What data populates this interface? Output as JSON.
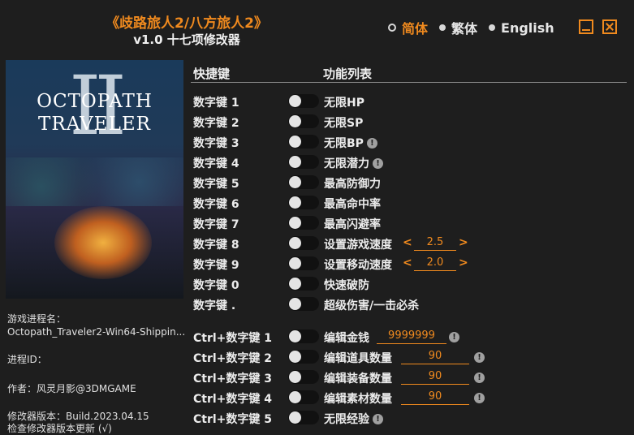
{
  "header": {
    "title": "《歧路旅人2/八方旅人2》",
    "subtitle": "v1.0 十七项修改器"
  },
  "languages": [
    {
      "label": "简体",
      "selected": true
    },
    {
      "label": "繁体",
      "selected": false
    },
    {
      "label": "English",
      "selected": false
    }
  ],
  "window_buttons": {
    "minimize": "minimize-icon",
    "close": "close-icon"
  },
  "cover": {
    "title_line1": "OCTOPATH",
    "title_line2": "TRAVELER",
    "numeral": "II"
  },
  "info": {
    "process_label": "游戏进程名：",
    "process_value": "Octopath_Traveler2-Win64-Shippin...",
    "pid_label": "进程ID：",
    "author": "作者：风灵月影@3DMGAME",
    "version": "修改器版本：Build.2023.04.15",
    "update": "检查修改器版本更新 (√)"
  },
  "table_headers": {
    "hotkey": "快捷键",
    "features": "功能列表"
  },
  "cheats": [
    {
      "hotkey": "数字键 1",
      "name": "无限HP",
      "on": false
    },
    {
      "hotkey": "数字键 2",
      "name": "无限SP",
      "on": false
    },
    {
      "hotkey": "数字键 3",
      "name": "无限BP",
      "on": false,
      "warning": true
    },
    {
      "hotkey": "数字键 4",
      "name": "无限潜力",
      "on": false,
      "warning": true
    },
    {
      "hotkey": "数字键 5",
      "name": "最高防御力",
      "on": false
    },
    {
      "hotkey": "数字键 6",
      "name": "最高命中率",
      "on": false
    },
    {
      "hotkey": "数字键 7",
      "name": "最高闪避率",
      "on": false
    },
    {
      "hotkey": "数字键 8",
      "name": "设置游戏速度",
      "on": false,
      "value": "2.5",
      "dec": "<",
      "inc": ">"
    },
    {
      "hotkey": "数字键 9",
      "name": "设置移动速度",
      "on": false,
      "value": "2.0",
      "dec": "<",
      "inc": ">"
    },
    {
      "hotkey": "数字键 0",
      "name": "快速破防",
      "on": false
    },
    {
      "hotkey": "数字键 .",
      "name": "超级伤害/一击必杀",
      "on": false
    },
    {
      "hotkey": "Ctrl+数字键 1",
      "name": "编辑金钱",
      "on": false,
      "input": "9999999",
      "warning": true
    },
    {
      "hotkey": "Ctrl+数字键 2",
      "name": "编辑道具数量",
      "on": false,
      "input": "90",
      "warning": true
    },
    {
      "hotkey": "Ctrl+数字键 3",
      "name": "编辑装备数量",
      "on": false,
      "input": "90",
      "warning": true
    },
    {
      "hotkey": "Ctrl+数字键 4",
      "name": "编辑素材数量",
      "on": false,
      "input": "90",
      "warning": true
    },
    {
      "hotkey": "Ctrl+数字键 5",
      "name": "无限经验",
      "on": false,
      "warning": true
    }
  ],
  "warning_glyph": "!",
  "colors": {
    "accent": "#f08a1e",
    "background": "#1e1e1e",
    "text": "#e6e6e6"
  }
}
